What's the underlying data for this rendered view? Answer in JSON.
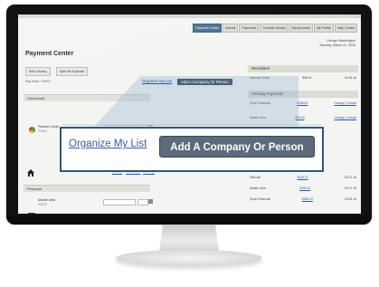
{
  "tabs": [
    {
      "label": "Payment Center",
      "active": true
    },
    {
      "label": "Activity",
      "active": false
    },
    {
      "label": "Payments",
      "active": false
    },
    {
      "label": "Transfer Money",
      "active": false
    },
    {
      "label": "My Accounts",
      "active": false
    },
    {
      "label": "My Profile",
      "active": false
    },
    {
      "label": "Help Center",
      "active": false
    }
  ],
  "user": {
    "name": "George Washington",
    "date": "Monday, March 21, 2016"
  },
  "page_title": "Payment Center",
  "actions": {
    "send_money": "Send Money",
    "split": "Split the Expense"
  },
  "pay_from": "Pay From: *XXXX",
  "sections": {
    "household": "Household",
    "personal": "Personal"
  },
  "household_rows": [
    {
      "label": "Federal Credit",
      "sub": "TXXX"
    },
    {
      "label": "Super F...",
      "sub": ""
    }
  ],
  "household_links": [
    "Activity",
    "Reminders",
    "AutoPay"
  ],
  "personal_rows": [
    {
      "label": "Mobile Ultra",
      "sub": "*0123"
    }
  ],
  "right_panel": {
    "reminders_title": "Reminders",
    "reminder_rows": [
      {
        "name": "National Credit",
        "amount": "$95.00",
        "date": "03-18-16"
      }
    ],
    "pending_title": "Pending Payments",
    "pending_rows": [
      {
        "name": "Super Financial",
        "amount": "$298.00",
        "action": "Change | Cancel"
      },
      {
        "name": "Mobile Ultra",
        "amount": "$95.00",
        "action": "Change | Cancel"
      },
      {
        "name": "Telecom",
        "amount": "$106.13",
        "action": "03-17-16"
      },
      {
        "name": "Mobile Ultra",
        "amount": "$196.13",
        "action": "03-17-16"
      },
      {
        "name": "Super Financial",
        "amount": "$285.00",
        "action": "03-08-16"
      }
    ]
  },
  "callout": {
    "small_link": "Organize My List",
    "small_button": "Add A Company Or Person",
    "organize_label": "Organize My List",
    "add_button_label": "Add A Company Or Person"
  },
  "colors": {
    "accent": "#4a6f8c",
    "button": "#5d6a7b",
    "link": "#3a5aa8",
    "bezel": "#111214"
  }
}
